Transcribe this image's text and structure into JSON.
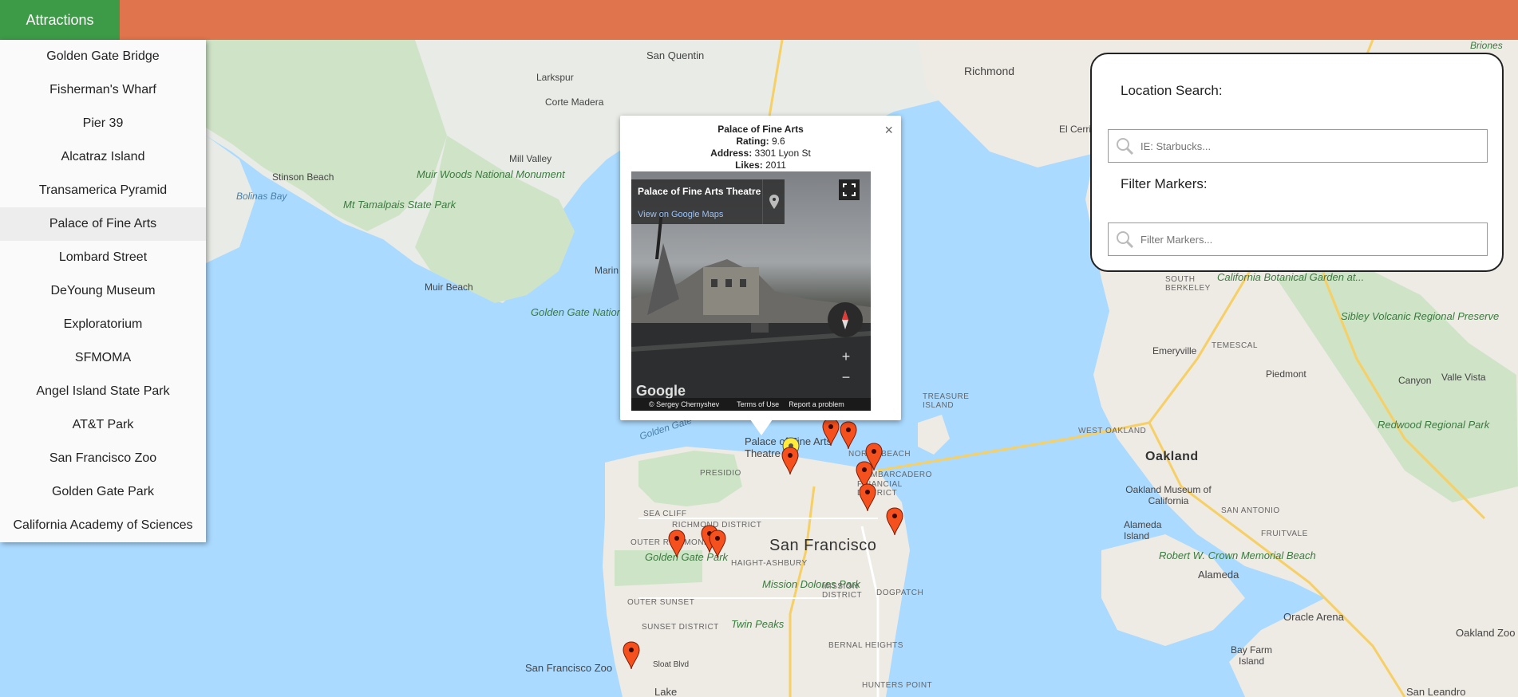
{
  "topbar": {
    "attractions_label": "Attractions"
  },
  "sidebar": {
    "items": [
      {
        "label": "Golden Gate Bridge"
      },
      {
        "label": "Fisherman's Wharf"
      },
      {
        "label": "Pier 39"
      },
      {
        "label": "Alcatraz Island"
      },
      {
        "label": "Transamerica Pyramid"
      },
      {
        "label": "Palace of Fine Arts",
        "active": true
      },
      {
        "label": "Lombard Street"
      },
      {
        "label": "DeYoung Museum"
      },
      {
        "label": "Exploratorium"
      },
      {
        "label": "SFMOMA"
      },
      {
        "label": "Angel Island State Park"
      },
      {
        "label": "AT&T Park"
      },
      {
        "label": "San Francisco Zoo"
      },
      {
        "label": "Golden Gate Park"
      },
      {
        "label": "California Academy of Sciences"
      }
    ]
  },
  "search_panel": {
    "location_label": "Location Search:",
    "location_placeholder": "IE: Starbucks...",
    "filter_label": "Filter Markers:",
    "filter_placeholder": "Filter Markers..."
  },
  "info_window": {
    "title": "Palace of Fine Arts",
    "rating_label": "Rating:",
    "rating_value": "9.6",
    "address_label": "Address:",
    "address_value": "3301 Lyon St",
    "likes_label": "Likes:",
    "likes_value": "2011",
    "close_glyph": "×",
    "streetview": {
      "place_name": "Palace of Fine Arts Theatre",
      "maps_link": "View on Google Maps",
      "logo_text": "Google",
      "copyright": "© Sergey Chernyshev",
      "terms": "Terms of Use",
      "report": "Report a problem",
      "zoom_in": "+",
      "zoom_out": "−"
    }
  },
  "map": {
    "labels": {
      "san_francisco": "San Francisco",
      "oakland": "Oakland",
      "richmond": "Richmond",
      "san_quentin": "San Quentin",
      "larkspur": "Larkspur",
      "corte_madera": "Corte Madera",
      "mill_valley": "Mill Valley",
      "stinson_beach": "Stinson Beach",
      "muir_beach": "Muir Beach",
      "bolinas_bay": "Bolinas Bay",
      "muir_woods": "Muir Woods National Monument",
      "mt_tamalpais": "Mt Tamalpais State Park",
      "ggnra": "Golden Gate National Recreation Area",
      "golden_gate_water": "Golden Gate",
      "marin": "Marin",
      "emeryville": "Emeryville",
      "piedmont": "Piedmont",
      "alameda": "Alameda",
      "alameda_island": "Alameda Island",
      "canyon": "Canyon",
      "vista": "Valle Vista",
      "el_cerrito": "El Cerrito",
      "berkeley_garden": "California Botanical Garden at...",
      "sibley": "Sibley Volcanic Regional Preserve",
      "redwood": "Redwood Regional Park",
      "oakland_museum": "Oakland Museum of California",
      "crown_beach": "Robert W. Crown Memorial Beach",
      "oracle_arena": "Oracle Arena",
      "oakland_zoo": "Oakland Zoo",
      "bay_farm": "Bay Farm Island",
      "san_leandro": "San Leandro",
      "sf_zoo": "San Francisco Zoo",
      "sloat": "Sloat Blvd",
      "golden_gate_park": "Golden Gate Park",
      "mission_dolores": "Mission Dolores Park",
      "twin_peaks": "Twin Peaks",
      "palace_label": "Palace of Fine Arts Theatre",
      "presidio": "PRESIDIO",
      "north_beach": "NORTH BEACH",
      "embarcadero": "EMBARCADERO",
      "financial": "FINANCIAL DISTRICT",
      "sea_cliff": "SEA CLIFF",
      "richmond_district": "RICHMOND DISTRICT",
      "outer_richmond": "OUTER RICHMOND",
      "outer_sunset": "OUTER SUNSET",
      "sunset_district": "SUNSET DISTRICT",
      "haight": "HAIGHT-ASHBURY",
      "mission_district": "MISSION DISTRICT",
      "dogpatch": "DOGPATCH",
      "bernal": "BERNAL HEIGHTS",
      "hunters": "HUNTERS POINT",
      "treasure_island": "TREASURE ISLAND",
      "west_oakland": "WEST OAKLAND",
      "temescal": "TEMESCAL",
      "south_berkeley": "SOUTH BERKELEY",
      "san_antonio": "SAN ANTONIO",
      "fruitvale": "FRUITVALE",
      "briones": "Briones",
      "oakland_label": "Oakland",
      "lake": "Lake"
    }
  }
}
